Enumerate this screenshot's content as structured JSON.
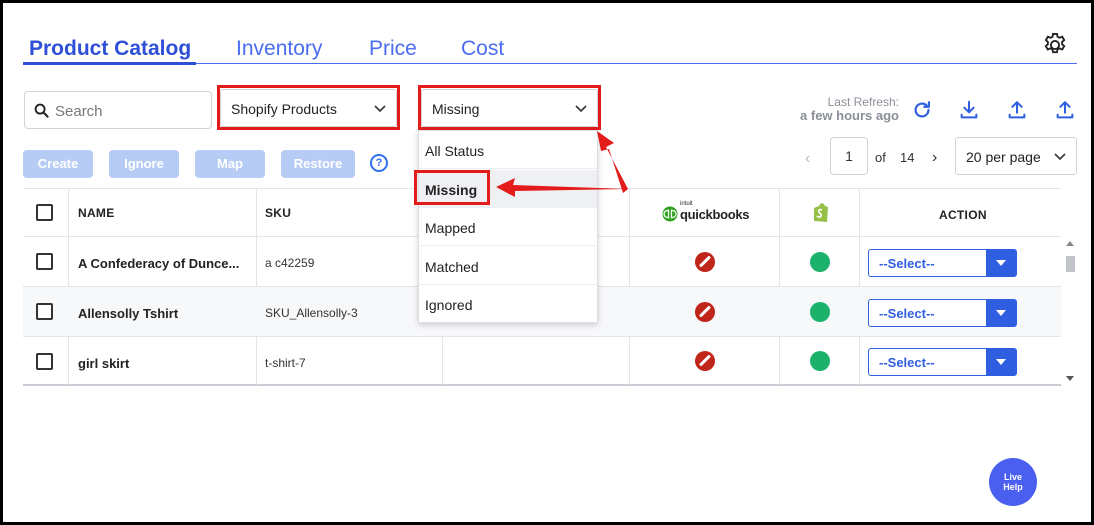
{
  "tabs": [
    {
      "label": "Product Catalog",
      "active": true
    },
    {
      "label": "Inventory",
      "active": false
    },
    {
      "label": "Price",
      "active": false
    },
    {
      "label": "Cost",
      "active": false
    }
  ],
  "search": {
    "placeholder": "Search"
  },
  "source_select": {
    "value": "Shopify Products"
  },
  "status_select": {
    "value": "Missing"
  },
  "status_options": [
    "All Status",
    "Missing",
    "Mapped",
    "Matched",
    "Ignored"
  ],
  "buttons": {
    "create": "Create",
    "ignore": "Ignore",
    "map": "Map",
    "restore": "Restore",
    "help": "?"
  },
  "refresh": {
    "label": "Last Refresh:",
    "value": "a few hours ago"
  },
  "pagination": {
    "current_page": "1",
    "of_label": "of",
    "total_pages": "14",
    "per_page": "20 per page"
  },
  "table": {
    "headers": {
      "name": "NAME",
      "sku": "SKU",
      "action": "ACTION"
    },
    "quickbooks_logo_text": "quickbooks",
    "quickbooks_logo_sub": "intuit",
    "rows": [
      {
        "name": "A Confederacy of Dunce...",
        "sku": "a c42259",
        "qb_status": "not-synced",
        "shopify_status": "active",
        "action": "--Select--"
      },
      {
        "name": "Allensolly Tshirt",
        "sku": "SKU_Allensolly-3",
        "qb_status": "not-synced",
        "shopify_status": "active",
        "action": "--Select--"
      },
      {
        "name": "girl skirt",
        "sku": "t-shirt-7",
        "qb_status": "not-synced",
        "shopify_status": "active",
        "action": "--Select--"
      }
    ]
  },
  "live_help": {
    "line1": "Live",
    "line2": "Help"
  },
  "colors": {
    "accent": "#2f4fd6",
    "highlight": "#e31b1b",
    "status_ok": "#1db26b",
    "status_bad": "#c0251a"
  },
  "icons": [
    "gear-icon",
    "search-icon",
    "chevron-down-icon",
    "refresh-icon",
    "download-icon",
    "upload-icon",
    "help-icon",
    "quickbooks-logo",
    "shopify-logo"
  ]
}
